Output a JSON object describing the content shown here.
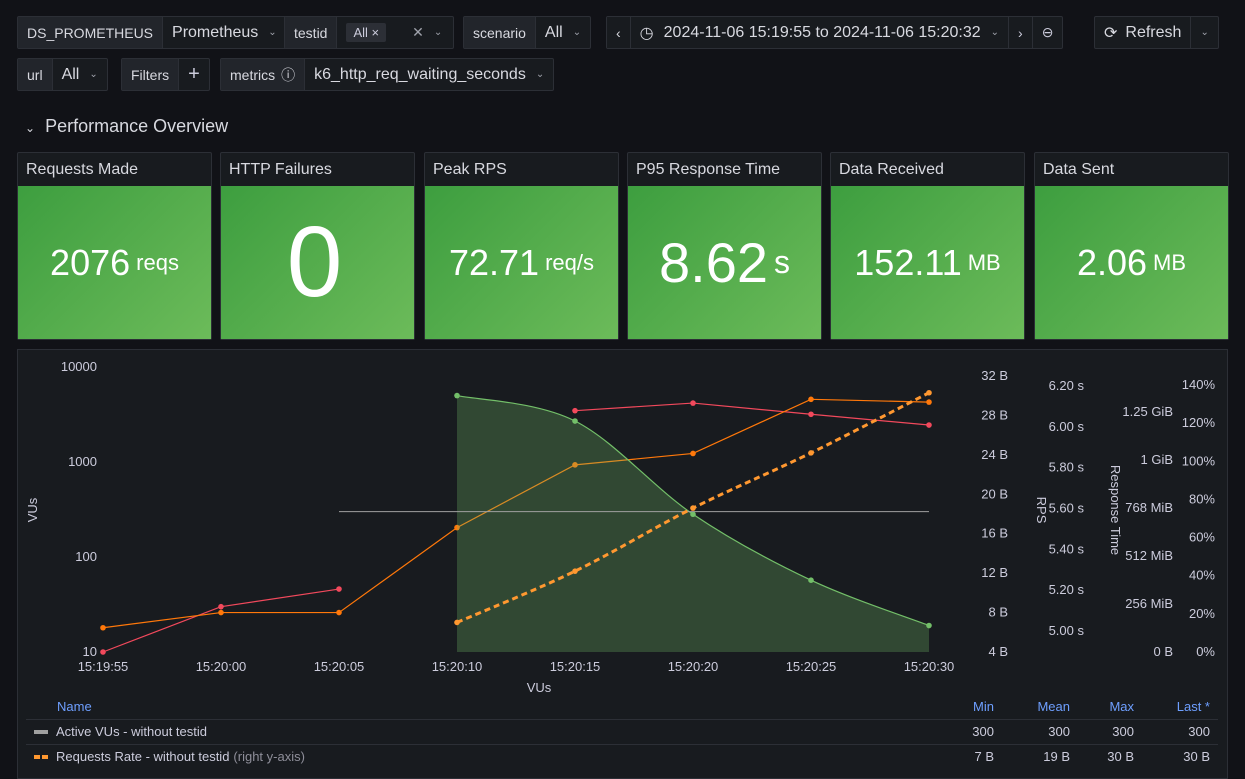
{
  "vars": {
    "ds_label": "DS_PROMETHEUS",
    "ds_value": "Prometheus",
    "testid_label": "testid",
    "testid_chip": "All ×",
    "scenario_label": "scenario",
    "scenario_value": "All",
    "url_label": "url",
    "url_value": "All",
    "filters_label": "Filters",
    "metrics_label": "metrics",
    "metrics_value": "k6_http_req_waiting_seconds"
  },
  "time": {
    "range": "2024-11-06 15:19:55 to 2024-11-06 15:20:32",
    "refresh": "Refresh"
  },
  "section": "Performance Overview",
  "stats": [
    {
      "title": "Requests Made",
      "value": "2076",
      "unit": "reqs"
    },
    {
      "title": "HTTP Failures",
      "value": "0",
      "unit": ""
    },
    {
      "title": "Peak RPS",
      "value": "72.71",
      "unit": "req/s"
    },
    {
      "title": "P95 Response Time",
      "value": "8.62",
      "unit": "s"
    },
    {
      "title": "Data Received",
      "value": "152.11",
      "unit": "MB"
    },
    {
      "title": "Data Sent",
      "value": "2.06",
      "unit": "MB"
    }
  ],
  "colors": {
    "stat_bg": "#52a94a",
    "red": "#f2495c",
    "orange": "#ff9830",
    "orange2": "#ff780a",
    "green": "#73bf69",
    "gray": "#a0a0a0"
  },
  "chart_data": {
    "type": "line",
    "xlabel": "VUs",
    "ylabel": "VUs",
    "yscale": "log",
    "ylim": [
      10,
      10000
    ],
    "x": [
      "15:19:55",
      "15:20:00",
      "15:20:05",
      "15:20:10",
      "15:20:15",
      "15:20:20",
      "15:20:25",
      "15:20:30"
    ],
    "yticks": [
      "10",
      "100",
      "1000",
      "10000"
    ],
    "right_axes": [
      {
        "ticks": [
          "4 B",
          "8 B",
          "12 B",
          "16 B",
          "20 B",
          "24 B",
          "28 B",
          "32 B"
        ],
        "label": ""
      },
      {
        "ticks": [
          "5.00 s",
          "5.20 s",
          "5.40 s",
          "5.60 s",
          "5.80 s",
          "6.00 s",
          "6.20 s"
        ],
        "label": "RPS"
      },
      {
        "ticks": [
          "0 B",
          "256 MiB",
          "512 MiB",
          "768 MiB",
          "1 GiB",
          "1.25 GiB"
        ],
        "label": "Response Time"
      },
      {
        "ticks": [
          "0%",
          "20%",
          "40%",
          "60%",
          "80%",
          "100%",
          "120%",
          "140%"
        ],
        "label": ""
      }
    ],
    "series": [
      {
        "color": "#f2495c",
        "values": [
          10,
          30,
          46,
          null,
          3470,
          4170,
          3180,
          2450
        ]
      },
      {
        "color": "#ff780a",
        "values": [
          18,
          26,
          26,
          204,
          933,
          1230,
          4570,
          4270
        ]
      },
      {
        "color": "#73bf69",
        "fill": true,
        "values": [
          null,
          null,
          null,
          5000,
          2700,
          282,
          57,
          19
        ]
      },
      {
        "name": "Active VUs - without testid",
        "color": "#a0a0a0",
        "values": [
          null,
          null,
          300,
          300,
          300,
          300,
          300,
          300
        ]
      },
      {
        "name": "Requests Rate - without testid",
        "axis": "right",
        "color": "#ff9830",
        "dashed": true,
        "values_bytes": [
          null,
          null,
          null,
          7,
          12.2,
          18.6,
          24.2,
          30.3
        ]
      }
    ]
  },
  "legend": {
    "headers": [
      "Name",
      "Min",
      "Mean",
      "Max",
      "Last *"
    ],
    "rows": [
      {
        "name": "Active VUs - without testid",
        "suffix": "",
        "min": "300",
        "mean": "300",
        "max": "300",
        "last": "300"
      },
      {
        "name": "Requests Rate - without testid",
        "suffix": "(right y-axis)",
        "min": "7 B",
        "mean": "19 B",
        "max": "30 B",
        "last": "30 B"
      }
    ]
  }
}
